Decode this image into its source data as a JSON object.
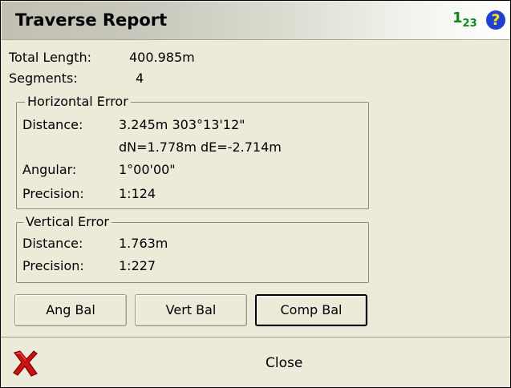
{
  "title": "Traverse Report",
  "icons": {
    "numeric_keypad": "123",
    "help": "?",
    "close": "red-x-icon"
  },
  "summary": {
    "total_length_label": "Total Length:",
    "total_length_value": "400.985m",
    "segments_label": "Segments:",
    "segments_value": "4"
  },
  "horizontal_error": {
    "legend": "Horizontal Error",
    "distance_label": "Distance:",
    "distance_value": "3.245m 303°13'12\"",
    "dn_de": "dN=1.778m dE=-2.714m",
    "angular_label": "Angular:",
    "angular_value": "1°00'00\"",
    "precision_label": "Precision:",
    "precision_value": "1:124"
  },
  "vertical_error": {
    "legend": "Vertical Error",
    "distance_label": "Distance:",
    "distance_value": "1.763m",
    "precision_label": "Precision:",
    "precision_value": "1:227"
  },
  "buttons": {
    "ang_bal": "Ang Bal",
    "vert_bal": "Vert Bal",
    "comp_bal": "Comp Bal"
  },
  "close_label": "Close",
  "colors": {
    "background": "#ecead8",
    "number_icon": "#0a8a1a",
    "help_icon_bg": "#1f3fd6",
    "help_icon_fg": "#ffe600",
    "close_icon": "#cc1111"
  }
}
